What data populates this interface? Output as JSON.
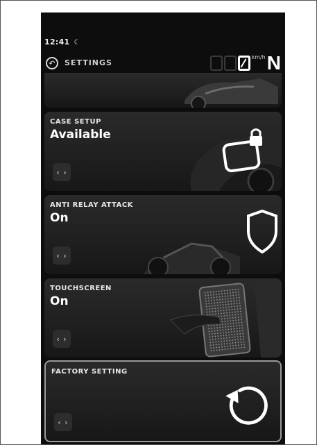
{
  "status": {
    "time": "12:41",
    "moon_icon": "moon-icon"
  },
  "header": {
    "title": "SETTINGS",
    "speed_digits": [
      "0",
      "0",
      "0"
    ],
    "speed_unit": "km/h",
    "gear": "N"
  },
  "cards": [
    {
      "label": "CASE SETUP",
      "value": "Available",
      "icon": "lock-case-icon"
    },
    {
      "label": "ANTI RELAY ATTACK",
      "value": "On",
      "icon": "shield-icon"
    },
    {
      "label": "TOUCHSCREEN",
      "value": "On",
      "icon": "touchscreen-icon"
    },
    {
      "label": "FACTORY SETTING",
      "value": "",
      "icon": "reset-icon"
    }
  ],
  "arrows_label": "‹ ›"
}
